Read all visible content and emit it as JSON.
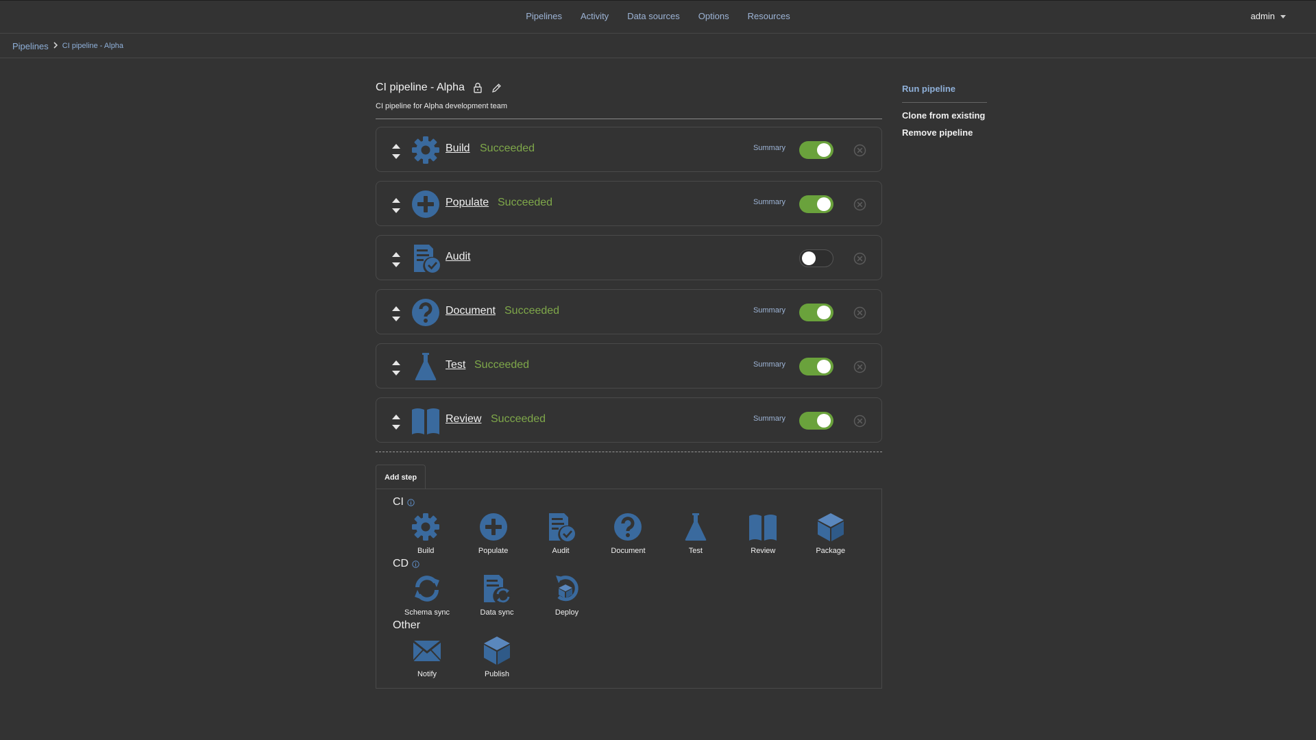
{
  "nav": {
    "items": [
      {
        "label": "Pipelines"
      },
      {
        "label": "Activity"
      },
      {
        "label": "Data sources"
      },
      {
        "label": "Options"
      },
      {
        "label": "Resources"
      }
    ],
    "user": "admin"
  },
  "breadcrumb": {
    "root": "Pipelines",
    "current": "CI pipeline - Alpha"
  },
  "pipeline": {
    "title": "CI pipeline - Alpha",
    "description": "CI pipeline for Alpha development team"
  },
  "steps": [
    {
      "name": "Build",
      "status": "Succeeded",
      "summary": "Summary",
      "enabled": true,
      "icon": "gear-icon"
    },
    {
      "name": "Populate",
      "status": "Succeeded",
      "summary": "Summary",
      "enabled": true,
      "icon": "plus-circle-icon"
    },
    {
      "name": "Audit",
      "status": "",
      "summary": "",
      "enabled": false,
      "icon": "audit-document-icon"
    },
    {
      "name": "Document",
      "status": "Succeeded",
      "summary": "Summary",
      "enabled": true,
      "icon": "question-circle-icon"
    },
    {
      "name": "Test",
      "status": "Succeeded",
      "summary": "Summary",
      "enabled": true,
      "icon": "flask-icon"
    },
    {
      "name": "Review",
      "status": "Succeeded",
      "summary": "Summary",
      "enabled": true,
      "icon": "book-icon"
    }
  ],
  "add_step": {
    "tab_label": "Add step",
    "groups": [
      {
        "title": "CI",
        "has_info": true,
        "tiles": [
          {
            "label": "Build",
            "icon": "gear-icon"
          },
          {
            "label": "Populate",
            "icon": "plus-circle-icon"
          },
          {
            "label": "Audit",
            "icon": "audit-document-icon"
          },
          {
            "label": "Document",
            "icon": "question-circle-icon"
          },
          {
            "label": "Test",
            "icon": "flask-icon"
          },
          {
            "label": "Review",
            "icon": "book-icon"
          },
          {
            "label": "Package",
            "icon": "package-icon"
          }
        ]
      },
      {
        "title": "CD",
        "has_info": true,
        "tiles": [
          {
            "label": "Schema sync",
            "icon": "sync-icon"
          },
          {
            "label": "Data sync",
            "icon": "data-sync-icon"
          },
          {
            "label": "Deploy",
            "icon": "deploy-icon"
          }
        ]
      },
      {
        "title": "Other",
        "has_info": false,
        "tiles": [
          {
            "label": "Notify",
            "icon": "envelope-icon"
          },
          {
            "label": "Publish",
            "icon": "publish-icon"
          }
        ]
      }
    ]
  },
  "actions": {
    "run": "Run pipeline",
    "clone": "Clone from existing",
    "remove": "Remove pipeline"
  },
  "colors": {
    "background": "#333333",
    "accent_blue": "#3a6a9e",
    "link_blue": "#9db4d6",
    "success_green": "#7fa84a",
    "toggle_on": "#6aa23c"
  }
}
